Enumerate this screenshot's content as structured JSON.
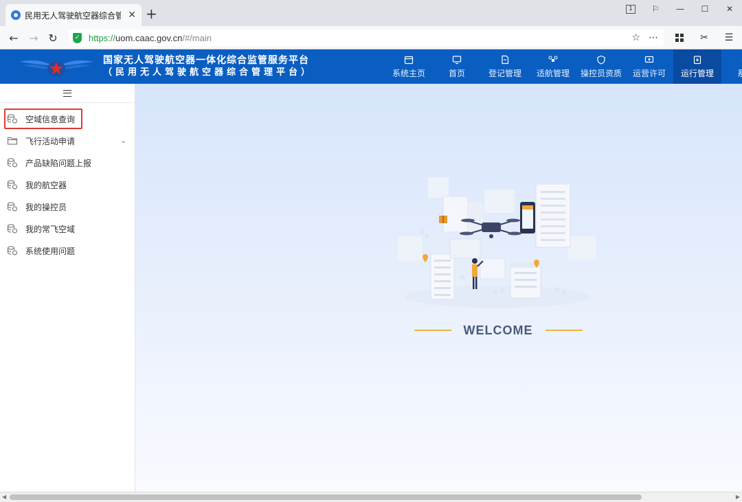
{
  "browser": {
    "tab_title": "民用无人驾驶航空器综合管理",
    "tab_close": "✕",
    "new_tab": "+",
    "url_scheme": "https://",
    "url_host": "uom.caac.gov.cn",
    "url_path": "/#/main",
    "window_controls": [
      "1",
      "⚐",
      "—",
      "☐",
      "✕"
    ]
  },
  "site": {
    "title_line1": "国家无人驾驶航空器一体化综合监管服务平台",
    "title_line2": "（民用无人驾驶航空器综合管理平台）"
  },
  "top_nav": {
    "items": [
      {
        "label": "系统主页",
        "icon": "calendar-icon"
      },
      {
        "label": "首页",
        "icon": "monitor-icon"
      },
      {
        "label": "登记管理",
        "icon": "document-edit-icon"
      },
      {
        "label": "适航管理",
        "icon": "drone-icon"
      },
      {
        "label": "操控员资质",
        "icon": "shield-icon"
      },
      {
        "label": "运营许可",
        "icon": "screen-icon"
      },
      {
        "label": "运行管理",
        "icon": "clipboard-icon",
        "active": true
      },
      {
        "label": "系统",
        "icon": "gear-icon"
      }
    ]
  },
  "sidebar": {
    "items": [
      {
        "label": "空域信息查询",
        "icon": "database-icon",
        "highlighted": true
      },
      {
        "label": "飞行活动申请",
        "icon": "folder-icon",
        "has_children": true
      },
      {
        "label": "产品缺陷问题上报",
        "icon": "database-icon"
      },
      {
        "label": "我的航空器",
        "icon": "database-icon"
      },
      {
        "label": "我的操控员",
        "icon": "database-icon"
      },
      {
        "label": "我的常飞空域",
        "icon": "database-icon"
      },
      {
        "label": "系统使用问题",
        "icon": "database-icon"
      }
    ]
  },
  "main": {
    "welcome_text": "WELCOME"
  },
  "colors": {
    "header_bg": "#0a5ec1",
    "active_nav_bg": "#0a4aa0",
    "highlight_border": "#e03b2f",
    "welcome_line": "#e8b53f"
  }
}
